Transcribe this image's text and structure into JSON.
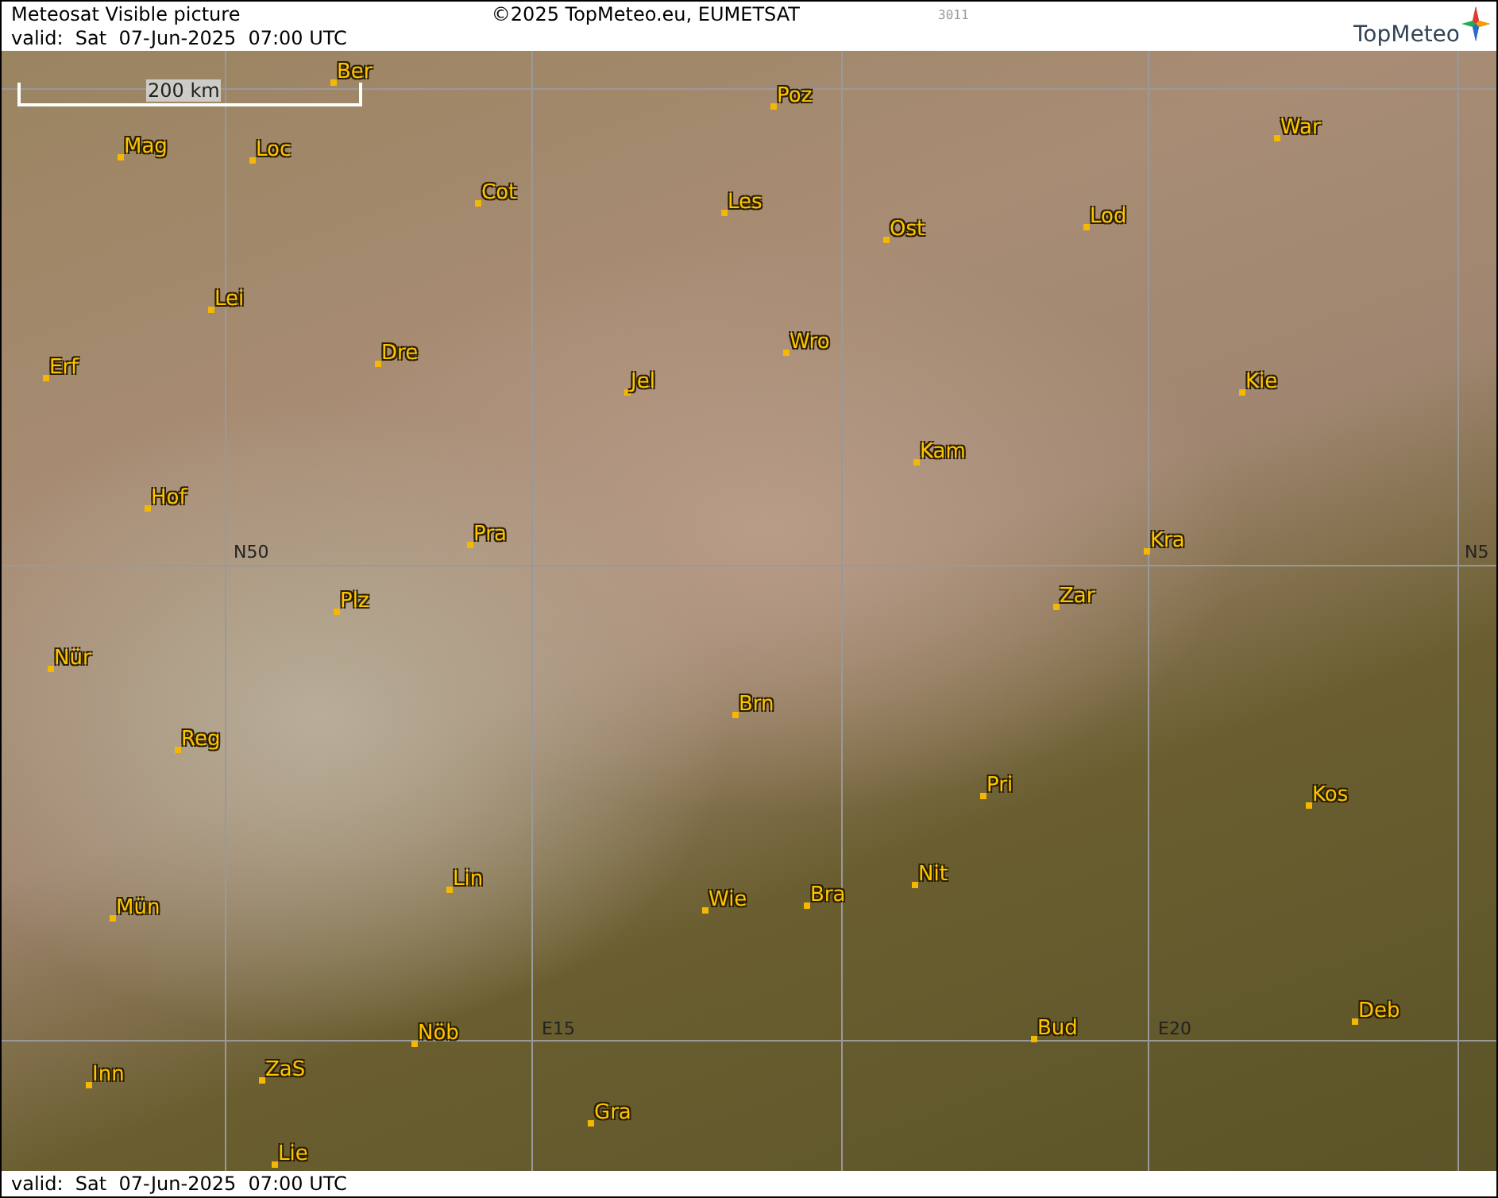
{
  "header": {
    "title": "Meteosat Visible picture",
    "copyright": "©2025 TopMeteo.eu, EUMETSAT",
    "code": "3011",
    "valid": "valid:  Sat  07-Jun-2025  07:00 UTC",
    "logo": "TopMeteo"
  },
  "map": {
    "scale": "200 km",
    "cities": [
      {
        "name": "Ber"
      },
      {
        "name": "Poz"
      },
      {
        "name": "War"
      },
      {
        "name": "Mag"
      },
      {
        "name": "Loc"
      },
      {
        "name": "Cot"
      },
      {
        "name": "Les"
      },
      {
        "name": "Lod"
      },
      {
        "name": "Ost"
      },
      {
        "name": "Lei"
      },
      {
        "name": "Wro"
      },
      {
        "name": "Dre"
      },
      {
        "name": "Erf"
      },
      {
        "name": "Jel"
      },
      {
        "name": "Kie"
      },
      {
        "name": "Kam"
      },
      {
        "name": "Hof"
      },
      {
        "name": "Pra"
      },
      {
        "name": "Kra"
      },
      {
        "name": "Zar"
      },
      {
        "name": "Plz"
      },
      {
        "name": "Nür"
      },
      {
        "name": "Brn"
      },
      {
        "name": "Reg"
      },
      {
        "name": "Pri"
      },
      {
        "name": "Kos"
      },
      {
        "name": "Lin"
      },
      {
        "name": "Nit"
      },
      {
        "name": "Bra"
      },
      {
        "name": "Wie"
      },
      {
        "name": "Mün"
      },
      {
        "name": "Deb"
      },
      {
        "name": "Bud"
      },
      {
        "name": "Nöb"
      },
      {
        "name": "Inn"
      },
      {
        "name": "ZaS"
      },
      {
        "name": "Gra"
      },
      {
        "name": "Lie"
      }
    ],
    "grid_labels": [
      {
        "text": "N50"
      },
      {
        "text": "N5"
      },
      {
        "text": "E15"
      },
      {
        "text": "E20"
      }
    ]
  },
  "footer": {
    "valid": "valid:  Sat  07-Jun-2025  07:00 UTC"
  }
}
